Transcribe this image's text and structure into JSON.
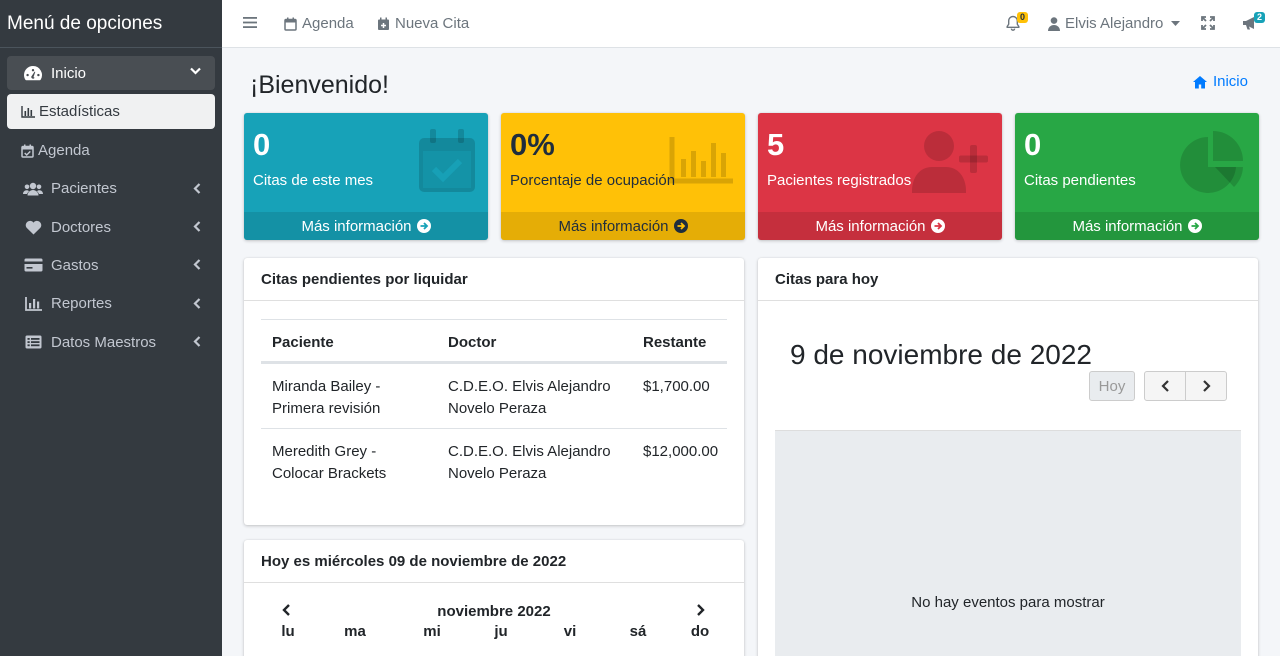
{
  "sidebar": {
    "brand": "Menú de opciones",
    "items": [
      {
        "label": "Inicio",
        "icon": "tachometer-icon"
      },
      {
        "label": "Estadísticas",
        "icon": "chart-bar-icon"
      },
      {
        "label": "Agenda",
        "icon": "calendar-check-icon"
      },
      {
        "label": "Pacientes",
        "icon": "users-icon"
      },
      {
        "label": "Doctores",
        "icon": "heart-icon"
      },
      {
        "label": "Gastos",
        "icon": "credit-card-icon"
      },
      {
        "label": "Reportes",
        "icon": "chart-bar-icon"
      },
      {
        "label": "Datos Maestros",
        "icon": "list-icon"
      }
    ]
  },
  "topbar": {
    "agenda": "Agenda",
    "nueva_cita": "Nueva Cita",
    "notifications_count": "0",
    "user": "Elvis Alejandro",
    "announcements_count": "2"
  },
  "page": {
    "title": "¡Bienvenido!",
    "breadcrumb": "Inicio"
  },
  "boxes": [
    {
      "value": "0",
      "label": "Citas de este mes",
      "footer": "Más información",
      "color": "#17a2b8"
    },
    {
      "value": "0%",
      "label": "Porcentaje de ocupación",
      "footer": "Más información",
      "color": "#ffc107"
    },
    {
      "value": "5",
      "label": "Pacientes registrados",
      "footer": "Más información",
      "color": "#dc3545"
    },
    {
      "value": "0",
      "label": "Citas pendientes",
      "footer": "Más información",
      "color": "#28a745"
    }
  ],
  "pending": {
    "title": "Citas pendientes por liquidar",
    "columns": [
      "Paciente",
      "Doctor",
      "Restante"
    ],
    "rows": [
      {
        "paciente1": "Miranda Bailey -",
        "paciente2": "Primera revisión",
        "doctor1": "C.D.E.O. Elvis Alejandro",
        "doctor2": "Novelo Peraza",
        "restante": "$1,700.00"
      },
      {
        "paciente1": "Meredith Grey -",
        "paciente2": "Colocar Brackets",
        "doctor1": "C.D.E.O. Elvis Alejandro",
        "doctor2": "Novelo Peraza",
        "restante": "$12,000.00"
      }
    ]
  },
  "today_calendar": {
    "title": "Hoy es miércoles 09 de noviembre de 2022",
    "month": "noviembre 2022",
    "weekdays": [
      "lu",
      "ma",
      "mi",
      "ju",
      "vi",
      "sá",
      "do"
    ]
  },
  "today_events": {
    "title": "Citas para hoy",
    "date": "9 de noviembre de 2022",
    "today_button": "Hoy",
    "empty": "No hay eventos para mostrar"
  }
}
